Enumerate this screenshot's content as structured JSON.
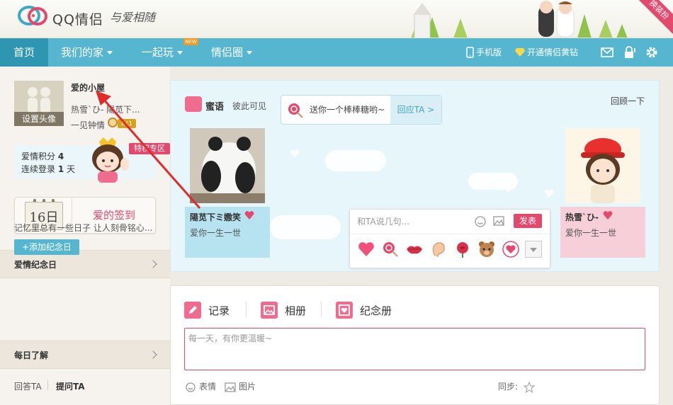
{
  "header": {
    "logo_text": "QQ情侣",
    "slogan": "与爱相随",
    "ribbon": "换装扮"
  },
  "nav": {
    "home": "首页",
    "our_home": "我们的家",
    "play_together": "一起玩",
    "new_badge": "NEW",
    "couple_circle": "情侣圈",
    "mobile": "手机版",
    "diamond": "开通情侣黄钻"
  },
  "sidebar": {
    "avatar_label": "设置头像",
    "house_title": "爱的小屋",
    "names": "热雪`ひ-  陽苋下...",
    "love_stage": "一见钟情",
    "level": "LV.1",
    "score_label": "爱情积分",
    "score_value": "4",
    "login_label": "连续登录",
    "login_value": "1",
    "login_unit": "天",
    "privilege": "特权专区",
    "checkin_day": "16日",
    "checkin_label": "爱的签到",
    "anniversary_title": "爱情纪念日",
    "anniversary_text": "记忆里总有一些日子 让人刻骨铭心...",
    "add_anniversary": "+添加纪念日",
    "daily_title": "每日了解",
    "qa_tab_answer": "回答TA",
    "qa_tab_ask": "提问TA"
  },
  "miyu": {
    "title": "蜜语",
    "visibility": "彼此可见",
    "lollipop_text": "送你一个棒棒糖哟~",
    "reply": "回应TA >",
    "review": "回顾一下",
    "left_card": {
      "name": "陽苋下ミ嫐笑",
      "motto": "爱你一生一世"
    },
    "right_card": {
      "name": "热雪`ひ-",
      "motto": "爱你一生一世"
    },
    "msg_placeholder": "和TA说几句...",
    "send": "发表"
  },
  "composer": {
    "tab_record": "记录",
    "tab_album": "相册",
    "tab_memorial": "纪念册",
    "placeholder": "每一天，有你更温暖~",
    "tool_emoji": "表情",
    "tool_image": "图片",
    "sync_label": "同步:"
  },
  "colors": {
    "nav_bg": "#56b6cf",
    "nav_active": "#2f96b1",
    "accent_pink": "#e3486d",
    "panel_bg": "#e6f6fb"
  }
}
